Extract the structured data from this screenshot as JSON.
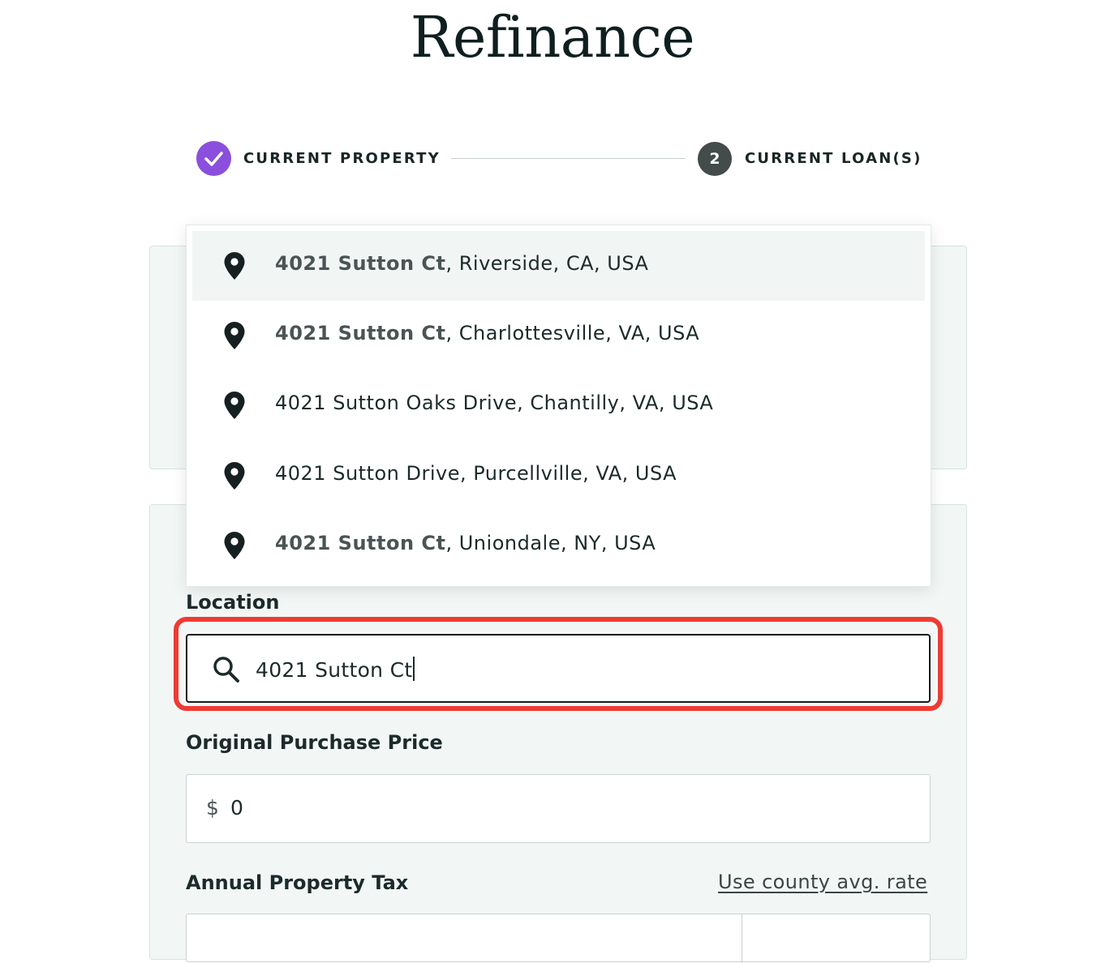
{
  "page": {
    "title": "Refinance"
  },
  "stepper": {
    "step1_label": "CURRENT PROPERTY",
    "step2_number": "2",
    "step2_label": "CURRENT LOAN(S)"
  },
  "suggestions": [
    {
      "match": "4021 Sutton Ct",
      "rest": ", Riverside, CA, USA"
    },
    {
      "match": "4021 Sutton Ct",
      "rest": ", Charlottesville, VA, USA"
    },
    {
      "match": "",
      "rest": "4021 Sutton Oaks Drive, Chantilly, VA, USA"
    },
    {
      "match": "",
      "rest": "4021 Sutton Drive, Purcellville, VA, USA"
    },
    {
      "match": "4021 Sutton Ct",
      "rest": ", Uniondale, NY, USA"
    }
  ],
  "location": {
    "label": "Location",
    "value": "4021 Sutton Ct"
  },
  "purchase_price": {
    "label": "Original Purchase Price",
    "currency": "$",
    "value": "0"
  },
  "property_tax": {
    "label": "Annual Property Tax",
    "link": "Use county avg. rate"
  },
  "colors": {
    "accent_purple": "#8a4fdc",
    "highlight_red": "#ee3b33",
    "card_bg": "#f2f7f6"
  }
}
